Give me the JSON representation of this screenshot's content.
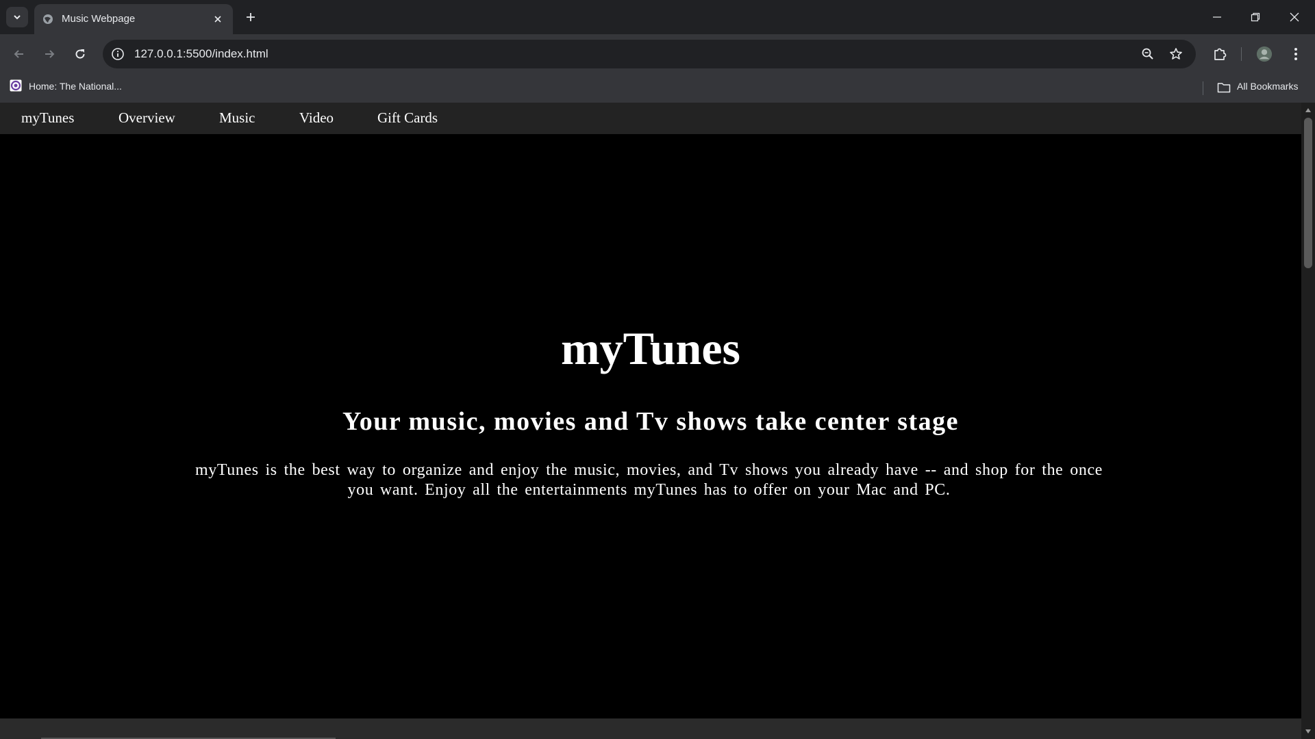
{
  "browser": {
    "tab": {
      "title": "Music Webpage"
    },
    "url": "127.0.0.1:5500/index.html",
    "bookmarks": {
      "items": [
        {
          "label": "Home: The National..."
        }
      ],
      "all_bookmarks_label": "All Bookmarks"
    },
    "icons": {
      "tab_search": "chevron-down-icon",
      "favicon": "globe-icon",
      "tab_close": "close-icon",
      "new_tab": "plus-icon",
      "minimize": "minimize-icon",
      "restore": "restore-icon",
      "close_window": "close-icon",
      "back": "arrow-left-icon",
      "forward": "arrow-right-icon",
      "reload": "reload-icon",
      "site_info": "info-icon",
      "zoom": "zoom-out-icon",
      "bookmark_star": "star-icon",
      "extensions": "puzzle-icon",
      "profile": "avatar-icon",
      "menu": "kebab-menu-icon",
      "folder": "folder-icon"
    }
  },
  "page": {
    "nav": [
      {
        "label": "myTunes"
      },
      {
        "label": "Overview"
      },
      {
        "label": "Music"
      },
      {
        "label": "Video"
      },
      {
        "label": "Gift Cards"
      }
    ],
    "hero": {
      "title": "myTunes",
      "subtitle": "Your music, movies and Tv shows take center stage",
      "body": "myTunes is the best way to organize and enjoy the music, movies, and Tv shows you already have -- and shop for the once you want. Enjoy all the entertainments myTunes has to offer on your Mac and PC."
    }
  },
  "colors": {
    "page_background": "#000000",
    "nav_background": "#232323",
    "text": "#ffffff",
    "chrome_dark": "#202124",
    "chrome_mid": "#35363a"
  }
}
